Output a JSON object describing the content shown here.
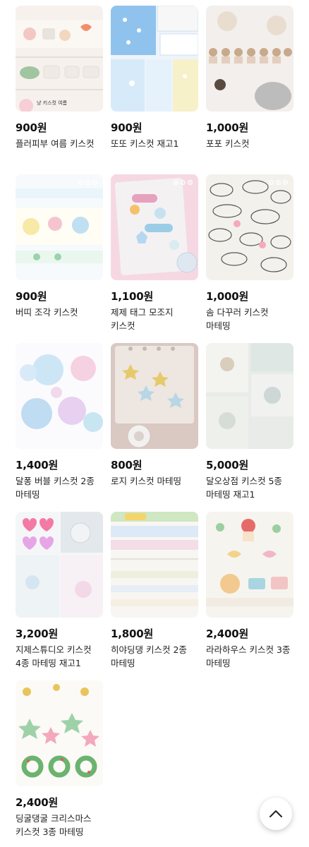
{
  "products": [
    {
      "price": "900원",
      "title": "플러피부 여름 키스컷",
      "thumb_caption": "냥 키스컷 여름"
    },
    {
      "price": "900원",
      "title": "또또 키스컷 재고1"
    },
    {
      "price": "1,000원",
      "title": "포포 키스컷"
    },
    {
      "price": "900원",
      "title": "버띠 조각 키스컷"
    },
    {
      "price": "1,100원",
      "title": "제제 태그 모조지 키스컷"
    },
    {
      "price": "1,000원",
      "title": "솜 다꾸러 키스컷 마테띵"
    },
    {
      "price": "1,400원",
      "title": "달퐁 버블 키스컷 2종 마테띵"
    },
    {
      "price": "800원",
      "title": "로지 키스컷 마테띵"
    },
    {
      "price": "5,000원",
      "title": "달오상점 키스컷 5종 마테띵 재고1"
    },
    {
      "price": "3,200원",
      "title": "지제스튜디오 키스컷 4종 마테띵 재고1"
    },
    {
      "price": "1,800원",
      "title": "히야딩댕 키스컷 2종 마테띵"
    },
    {
      "price": "2,400원",
      "title": "라라하우스 키스컷 3종 마테띵"
    },
    {
      "price": "2,400원",
      "title": "딩굴댕굴 크리스마스 키스컷 3종 마테띵"
    }
  ],
  "scroll_top_icon": "chevron-up-icon"
}
